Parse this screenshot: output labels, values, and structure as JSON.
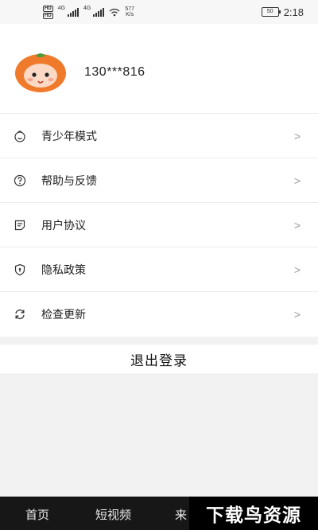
{
  "status_bar": {
    "hd1": "HD",
    "hd2": "HD",
    "net1": "4G",
    "net2": "4G",
    "speed_value": "577",
    "speed_unit": "K/s",
    "battery": "50",
    "time": "2:18"
  },
  "profile": {
    "avatar_icon": "orange-character-avatar",
    "phone": "130***816"
  },
  "menu": [
    {
      "label": "青少年模式",
      "icon": "child-face-icon"
    },
    {
      "label": "帮助与反馈",
      "icon": "question-circle-icon"
    },
    {
      "label": "用户协议",
      "icon": "document-icon"
    },
    {
      "label": "隐私政策",
      "icon": "shield-icon"
    },
    {
      "label": "检查更新",
      "icon": "refresh-icon"
    }
  ],
  "logout_label": "退出登录",
  "tabbar": {
    "tab_home": "首页",
    "tab_short_video": "短视频",
    "tab_partial": "来"
  },
  "watermark": "下载鸟资源",
  "colors": {
    "avatar_orange": "#f07a2c",
    "tabbar_bg": "#171717"
  }
}
